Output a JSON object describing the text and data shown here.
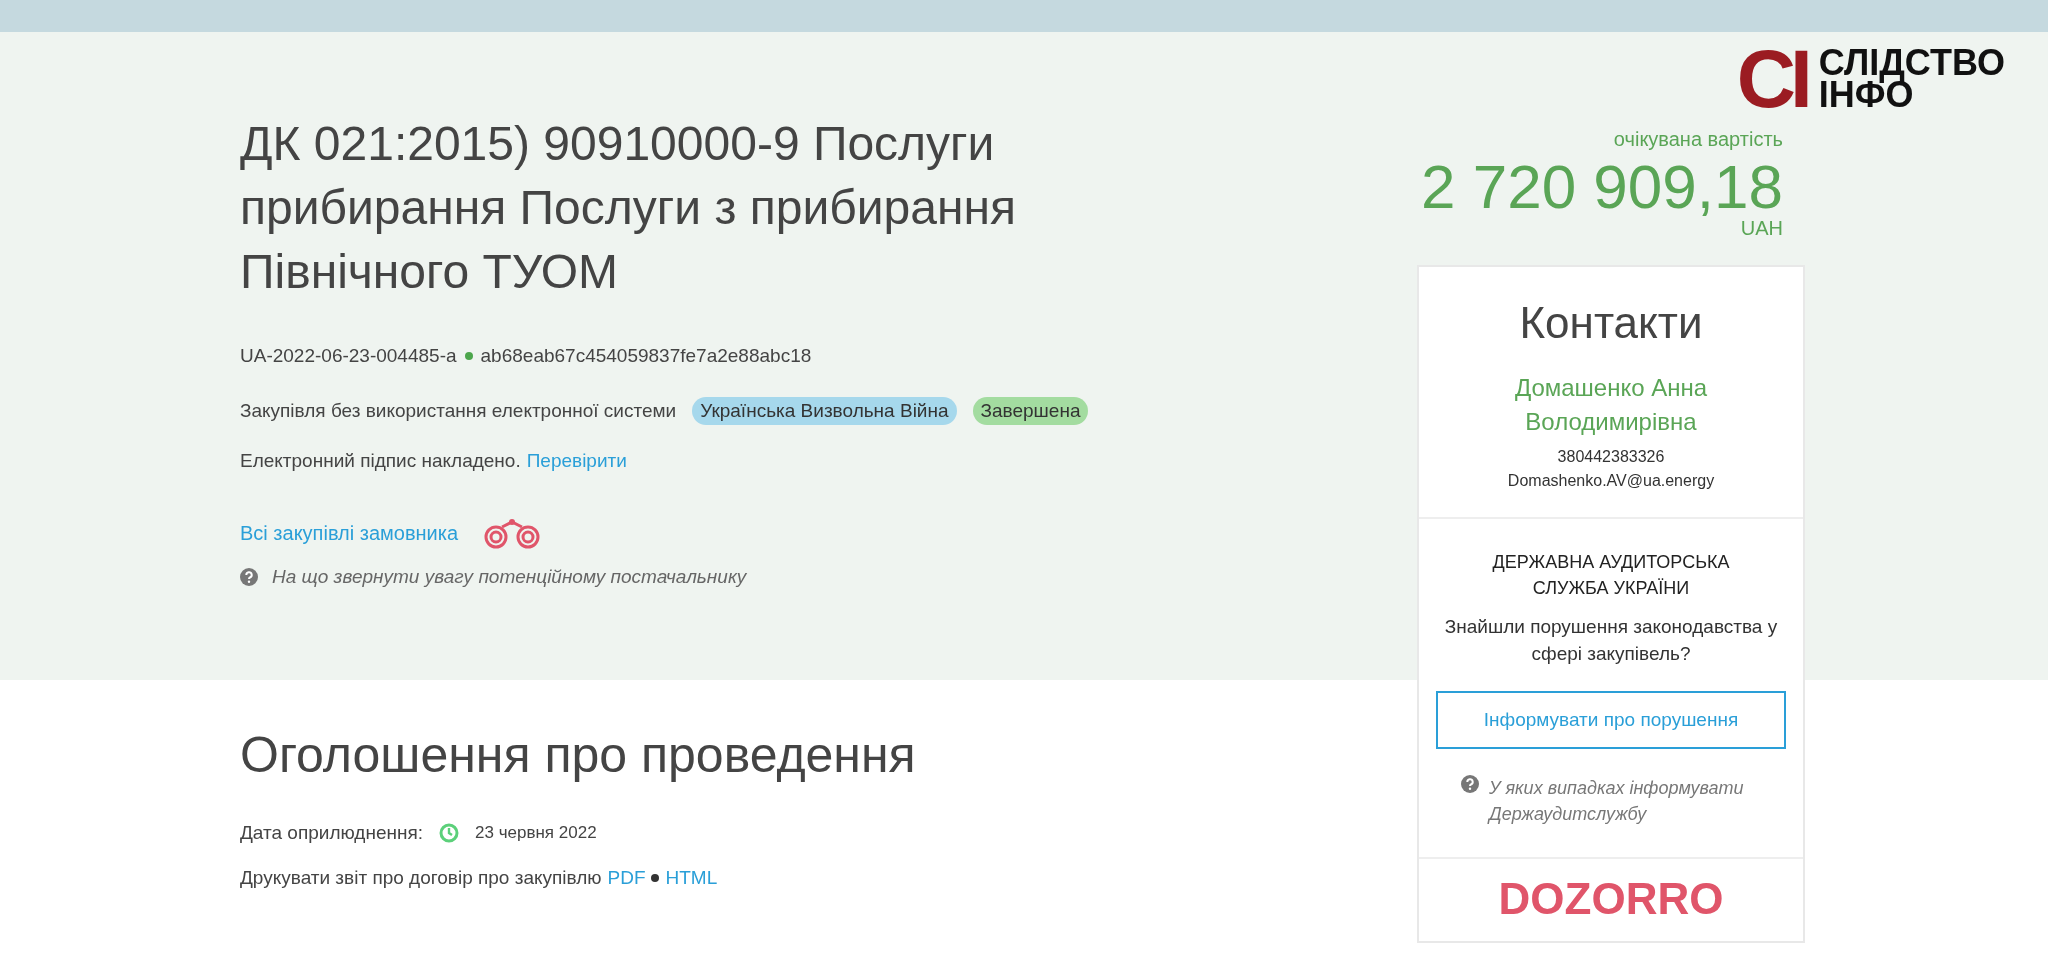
{
  "logo": {
    "mark": "СІ",
    "line_1": "СЛІДСТВО",
    "line_2": "ІНФО"
  },
  "tender": {
    "title": "ДК 021:2015) 90910000-9 Послуги прибирання Послуги з прибирання Північного ТУОМ",
    "id": "UA-2022-06-23-004485-a",
    "hash": "ab68eab67c454059837fe7a2e88abc18",
    "procedure": "Закупівля без використання електронної системи",
    "tags": [
      {
        "label": "Українська Визвольна Війна",
        "color": "#a6d8ec"
      },
      {
        "label": "Завершена",
        "color": "#a3dca0"
      }
    ],
    "signature": "Електронний підпис накладено.",
    "signature_link": "Перевірити",
    "buyer_link": "Всі закупівлі замовника",
    "hint": "На що звернути увагу потенційному постачальнику"
  },
  "price": {
    "label": "очікувана вартість",
    "amount": "2 720 909,18",
    "currency": "UAH"
  },
  "contacts": {
    "title": "Контакти",
    "name": "Домашенко Анна Володимирівна",
    "phone": "380442383326",
    "email": "Domashenko.AV@ua.energy"
  },
  "audit": {
    "title": "ДЕРЖАВНА АУДИТОРСЬКА СЛУЖБА УКРАЇНИ",
    "question": "Знайшли порушення законодавства у сфері закупівель?",
    "button": "Інформувати про порушення",
    "hint": "У яких випадках інформувати Держаудитслужбу"
  },
  "partner_logo": "DOZORRO",
  "announcement": {
    "heading": "Оголошення про проведення",
    "date_label": "Дата оприлюднення:",
    "date": "23 червня 2022",
    "print_label": "Друкувати звіт про договір про закупівлю",
    "print_links": [
      "PDF",
      "HTML"
    ]
  }
}
